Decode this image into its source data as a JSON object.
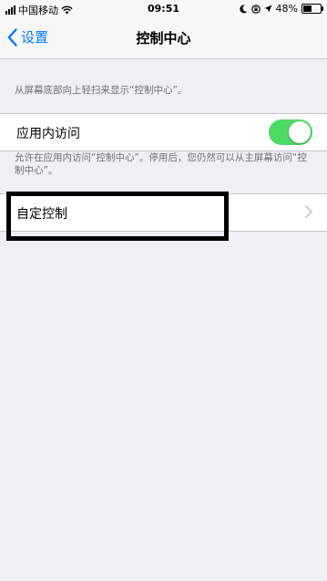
{
  "status_bar": {
    "carrier": "中国移动",
    "time": "09:51",
    "battery": "48%",
    "battery_level": 0.48,
    "icons": [
      "signal-icon",
      "wifi-icon",
      "moon-icon",
      "lock-rotation-icon",
      "location-icon",
      "battery-icon"
    ]
  },
  "nav": {
    "back_label": "设置",
    "title": "控制中心"
  },
  "main": {
    "top_note": "从屏幕底部向上轻扫来显示“控制中心”。",
    "in_app_access": {
      "label": "应用内访问",
      "enabled": true
    },
    "in_app_note": "允许在应用内访问“控制中心”。停用后，您仍然可以从主屏幕访问“控制中心”。",
    "customize": {
      "label": "自定控制"
    }
  },
  "colors": {
    "accent": "#007aff",
    "toggle_on": "#4cd964",
    "background": "#efeff4",
    "annotation": "#000000"
  }
}
